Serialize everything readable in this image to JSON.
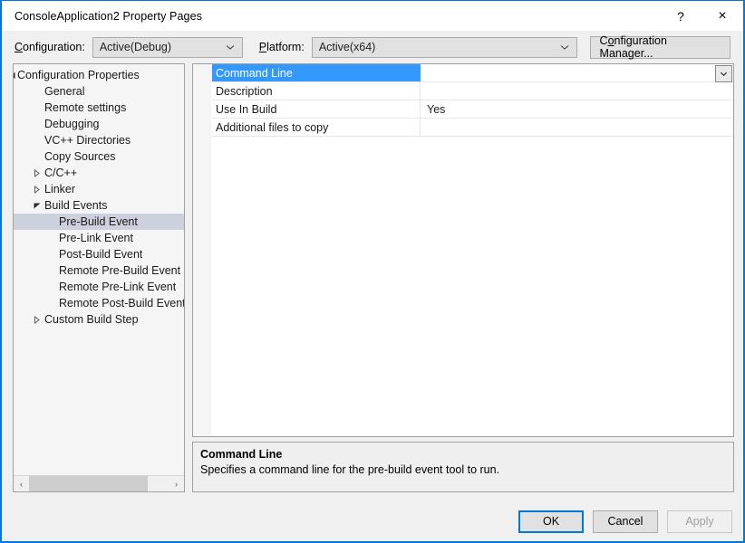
{
  "window": {
    "title": "ConsoleApplication2 Property Pages",
    "help_label": "?",
    "close_label": "×",
    "accent_color": "#0078d7",
    "selection_color": "#3399ff",
    "tree_selection_color": "#cdd0dd"
  },
  "config_bar": {
    "configuration_label": "Configuration:",
    "configuration_value": "Active(Debug)",
    "platform_label": "Platform:",
    "platform_value": "Active(x64)",
    "configuration_manager_label": "Configuration Manager..."
  },
  "tree": {
    "items": [
      {
        "label": "Configuration Properties",
        "indent": 0,
        "expander": "expanded-root",
        "selected": false
      },
      {
        "label": "General",
        "indent": 1,
        "expander": "none",
        "selected": false
      },
      {
        "label": "Remote settings",
        "indent": 1,
        "expander": "none",
        "selected": false
      },
      {
        "label": "Debugging",
        "indent": 1,
        "expander": "none",
        "selected": false
      },
      {
        "label": "VC++ Directories",
        "indent": 1,
        "expander": "none",
        "selected": false
      },
      {
        "label": "Copy Sources",
        "indent": 1,
        "expander": "none",
        "selected": false
      },
      {
        "label": "C/C++",
        "indent": 1,
        "expander": "collapsed",
        "selected": false
      },
      {
        "label": "Linker",
        "indent": 1,
        "expander": "collapsed",
        "selected": false
      },
      {
        "label": "Build Events",
        "indent": 1,
        "expander": "expanded",
        "selected": false
      },
      {
        "label": "Pre-Build Event",
        "indent": 2,
        "expander": "none",
        "selected": true
      },
      {
        "label": "Pre-Link Event",
        "indent": 2,
        "expander": "none",
        "selected": false
      },
      {
        "label": "Post-Build Event",
        "indent": 2,
        "expander": "none",
        "selected": false
      },
      {
        "label": "Remote Pre-Build Event",
        "indent": 2,
        "expander": "none",
        "selected": false
      },
      {
        "label": "Remote Pre-Link Event",
        "indent": 2,
        "expander": "none",
        "selected": false
      },
      {
        "label": "Remote Post-Build Event",
        "indent": 2,
        "expander": "none",
        "selected": false
      },
      {
        "label": "Custom Build Step",
        "indent": 1,
        "expander": "collapsed",
        "selected": false
      }
    ],
    "scroll_left_label": "‹",
    "scroll_right_label": "›"
  },
  "property_grid": {
    "rows": [
      {
        "name": "Command Line",
        "value": "",
        "selected": true
      },
      {
        "name": "Description",
        "value": "",
        "selected": false
      },
      {
        "name": "Use In Build",
        "value": "Yes",
        "selected": false
      },
      {
        "name": "Additional files to copy",
        "value": "",
        "selected": false
      }
    ]
  },
  "description": {
    "title": "Command Line",
    "text": "Specifies a command line for the pre-build event tool to run."
  },
  "footer": {
    "ok_label": "OK",
    "cancel_label": "Cancel",
    "apply_label": "Apply"
  }
}
